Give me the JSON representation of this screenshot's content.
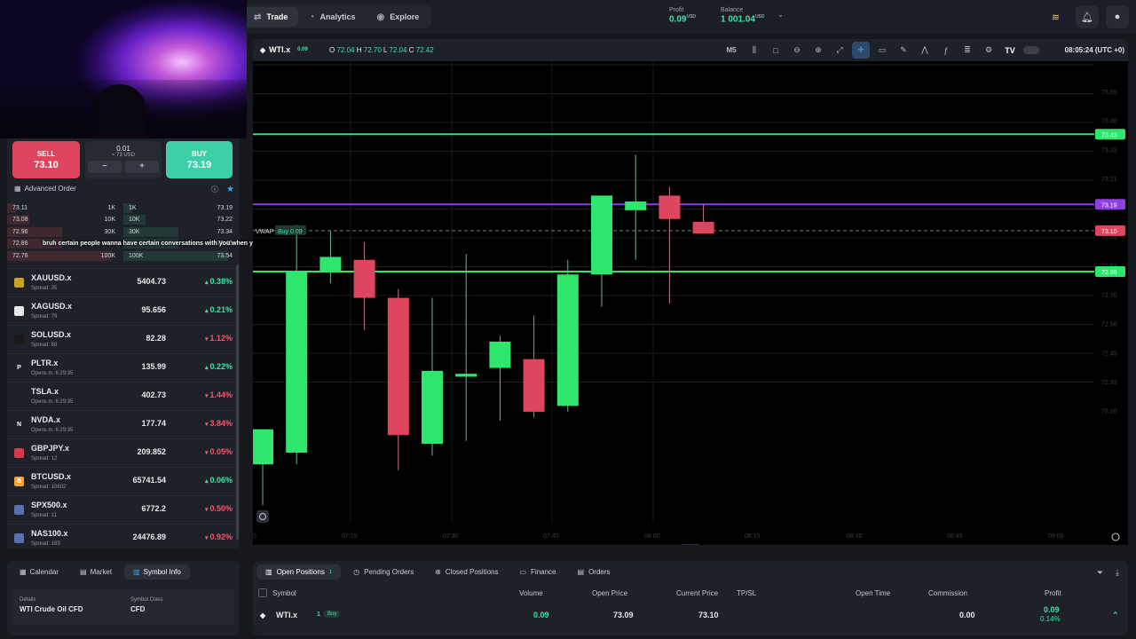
{
  "nav": {
    "tabs": [
      {
        "label": "Trade",
        "icon": "trade-icon"
      },
      {
        "label": "Analytics",
        "icon": "analytics-icon"
      },
      {
        "label": "Explore",
        "icon": "explore-icon"
      }
    ]
  },
  "account": {
    "profit_label": "Profit",
    "profit_value": "0.09",
    "profit_unit": "USD",
    "balance_label": "Balance",
    "balance_value": "1 001.04",
    "balance_unit": "USD"
  },
  "order_panel": {
    "sell_label": "SELL",
    "sell_price": "73.10",
    "buy_label": "BUY",
    "buy_price": "73.19",
    "quantity": "0.01",
    "quantity_usd": "≈ 73 USD",
    "minus": "−",
    "plus": "+",
    "advanced_label": "Advanced Order"
  },
  "order_book": [
    {
      "bid": "73.11",
      "bid_vol": "1K",
      "ask_vol": "1K",
      "ask": "73.19",
      "bid_depth": 0.08,
      "ask_depth": 0.08
    },
    {
      "bid": "73.08",
      "bid_vol": "10K",
      "ask_vol": "10K",
      "ask": "73.22",
      "bid_depth": 0.2,
      "ask_depth": 0.2
    },
    {
      "bid": "72.96",
      "bid_vol": "30K",
      "ask_vol": "30K",
      "ask": "73.34",
      "bid_depth": 0.5,
      "ask_depth": 0.5
    },
    {
      "bid": "72.86",
      "bid_vol": "",
      "ask_vol": "",
      "ask": "73.45",
      "bid_depth": 0.5,
      "ask_depth": 0.5
    },
    {
      "bid": "72.76",
      "bid_vol": "100K",
      "ask_vol": "100K",
      "ask": "73.54",
      "bid_depth": 0.95,
      "ask_depth": 0.95
    }
  ],
  "stream_caption": "bruh certain people wanna have certain conversations with you when you get too rich",
  "watchlist": [
    {
      "symbol": "XAUUSD.x",
      "sub": "Spread: 35",
      "price": "5404.73",
      "change": "0.38%",
      "dir": "up",
      "logo_color": "#c9a227",
      "logo_text": "",
      "logo": "gold-icon"
    },
    {
      "symbol": "XAGUSD.x",
      "sub": "Spread: 79",
      "price": "95.656",
      "change": "0.21%",
      "dir": "up",
      "logo_color": "#e6e8ec",
      "logo_text": "",
      "logo": "silver-icon"
    },
    {
      "symbol": "SOLUSD.x",
      "sub": "Spread: 68",
      "price": "82.28",
      "change": "1.12%",
      "dir": "dn",
      "logo_color": "#1a1a1a",
      "logo_text": "",
      "logo": "solana-icon"
    },
    {
      "symbol": "PLTR.x",
      "sub": "Opens in: 6:29:35",
      "price": "135.99",
      "change": "0.22%",
      "dir": "up",
      "logo_color": "#1e2127",
      "logo_text": "P",
      "logo": "palantir-icon"
    },
    {
      "symbol": "TSLA.x",
      "sub": "Opens in: 6:29:35",
      "price": "402.73",
      "change": "1.44%",
      "dir": "dn",
      "logo_color": "#1e2127",
      "logo_text": "",
      "logo": "tesla-icon"
    },
    {
      "symbol": "NVDA.x",
      "sub": "Opens in: 6:29:35",
      "price": "177.74",
      "change": "3.84%",
      "dir": "dn",
      "logo_color": "#1e2127",
      "logo_text": "N",
      "logo": "nvidia-icon"
    },
    {
      "symbol": "GBPJPY.x",
      "sub": "Spread: 12",
      "price": "209.852",
      "change": "0.05%",
      "dir": "dn",
      "logo_color": "#d23b4f",
      "logo_text": "",
      "logo": "gbpjpy-flag-icon"
    },
    {
      "symbol": "BTCUSD.x",
      "sub": "Spread: 10602",
      "price": "65741.54",
      "change": "0.06%",
      "dir": "up",
      "logo_color": "#f2a33a",
      "logo_text": "B",
      "logo": "bitcoin-icon"
    },
    {
      "symbol": "SPX500.x",
      "sub": "Spread: 11",
      "price": "6772.2",
      "change": "0.50%",
      "dir": "dn",
      "logo_color": "#5a6fb3",
      "logo_text": "",
      "logo": "us-flag-icon"
    },
    {
      "symbol": "NAS100.x",
      "sub": "Spread: 163",
      "price": "24476.89",
      "change": "0.92%",
      "dir": "dn",
      "logo_color": "#5a6fb3",
      "logo_text": "",
      "logo": "us-flag-icon"
    }
  ],
  "chart_header": {
    "symbol": "WTI.x",
    "badge": "0.09",
    "o_label": "O",
    "o": "72.04",
    "h_label": "H",
    "h": "72.70",
    "l_label": "L",
    "l": "72.04",
    "c_label": "C",
    "c": "72.42",
    "timeframe": "M5",
    "time": "08:05:24 (UTC +0)"
  },
  "chart_data": {
    "type": "candlestick",
    "ylim": [
      72.1,
      73.68
    ],
    "candles": [
      {
        "o": 72.3,
        "h": 72.42,
        "l": 72.16,
        "c": 72.42
      },
      {
        "o": 72.34,
        "h": 73.12,
        "l": 72.3,
        "c": 72.96
      },
      {
        "o": 72.96,
        "h": 73.1,
        "l": 72.92,
        "c": 73.01
      },
      {
        "o": 73.0,
        "h": 73.06,
        "l": 72.76,
        "c": 72.87
      },
      {
        "o": 72.87,
        "h": 72.9,
        "l": 72.28,
        "c": 72.4
      },
      {
        "o": 72.37,
        "h": 72.87,
        "l": 72.33,
        "c": 72.62
      },
      {
        "o": 72.6,
        "h": 73.02,
        "l": 72.38,
        "c": 72.61
      },
      {
        "o": 72.63,
        "h": 72.74,
        "l": 72.45,
        "c": 72.72
      },
      {
        "o": 72.66,
        "h": 72.81,
        "l": 72.46,
        "c": 72.48
      },
      {
        "o": 72.5,
        "h": 73.0,
        "l": 72.48,
        "c": 72.95
      },
      {
        "o": 72.95,
        "h": 73.19,
        "l": 72.84,
        "c": 73.22
      },
      {
        "o": 73.17,
        "h": 73.36,
        "l": 73.0,
        "c": 73.2
      },
      {
        "o": 73.22,
        "h": 73.25,
        "l": 72.85,
        "c": 73.14
      },
      {
        "o": 73.13,
        "h": 73.19,
        "l": 73.09,
        "c": 73.09
      }
    ],
    "levels": [
      {
        "value": 73.43,
        "color": "#2ee66b",
        "label": "73.43"
      },
      {
        "value": 73.19,
        "color": "#8e3fe0",
        "label": "73.19"
      },
      {
        "value": 73.1,
        "color": "#e0455f",
        "label": "73.10"
      },
      {
        "value": 72.96,
        "color": "#2ee66b",
        "label": "72.96"
      }
    ],
    "vwap_label": "VWAP",
    "position_label": "Buy 0.09",
    "price_ticks": [
      "73.59",
      "73.46",
      "73.33",
      "73.21",
      "73.08",
      "72.95",
      "72.83",
      "72.70",
      "72.58",
      "72.45",
      "72.33",
      "72.20"
    ],
    "time_ticks": [
      "07:15",
      "07:30",
      "07:45",
      "08:00",
      "08:15",
      "08:30",
      "08:45",
      "09:00"
    ],
    "time_ticks_first": "5"
  },
  "bottom_left": {
    "tabs": [
      {
        "label": "Calendar",
        "icon": "calendar-icon"
      },
      {
        "label": "Market",
        "icon": "market-icon"
      },
      {
        "label": "Symbol Info",
        "icon": "info-icon"
      }
    ],
    "details_label": "Details",
    "details_value": "WTI Crude Oil CFD",
    "class_label": "Symbol Class",
    "class_value": "CFD"
  },
  "positions": {
    "tabs": [
      {
        "label": "Open Positions",
        "count": "1"
      },
      {
        "label": "Pending Orders",
        "count": ""
      },
      {
        "label": "Closed Positions",
        "count": ""
      },
      {
        "label": "Finance",
        "count": ""
      },
      {
        "label": "Orders",
        "count": ""
      }
    ],
    "columns": {
      "symbol": "Symbol",
      "volume": "Volume",
      "open_price": "Open Price",
      "current_price": "Current Price",
      "tpsl": "TP/SL",
      "open_time": "Open Time",
      "commission": "Commission",
      "profit": "Profit"
    },
    "rows": [
      {
        "symbol": "WTI.x",
        "qty": "1",
        "side": "Buy",
        "volume": "0.09",
        "open_price": "73.09",
        "current_price": "73.10",
        "commission": "0.00",
        "profit": "0.09",
        "profit_pct": "0.14%"
      }
    ]
  }
}
